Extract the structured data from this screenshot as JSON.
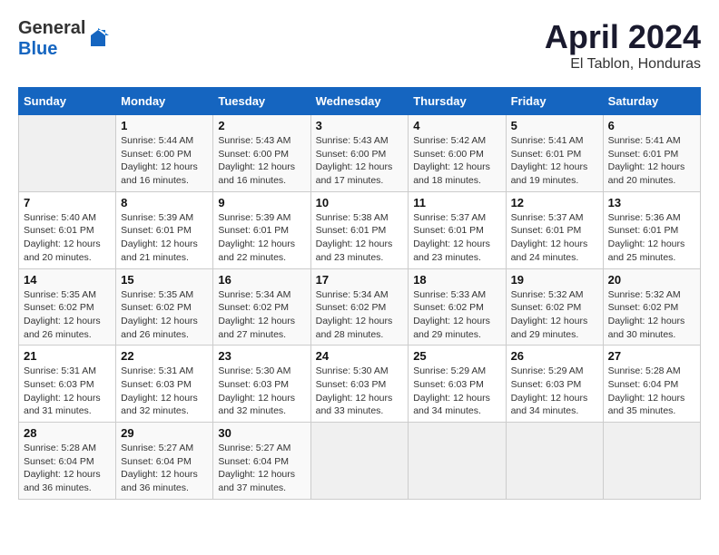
{
  "header": {
    "logo_general": "General",
    "logo_blue": "Blue",
    "title": "April 2024",
    "subtitle": "El Tablon, Honduras"
  },
  "calendar": {
    "columns": [
      "Sunday",
      "Monday",
      "Tuesday",
      "Wednesday",
      "Thursday",
      "Friday",
      "Saturday"
    ],
    "weeks": [
      [
        {
          "day": "",
          "info": ""
        },
        {
          "day": "1",
          "info": "Sunrise: 5:44 AM\nSunset: 6:00 PM\nDaylight: 12 hours\nand 16 minutes."
        },
        {
          "day": "2",
          "info": "Sunrise: 5:43 AM\nSunset: 6:00 PM\nDaylight: 12 hours\nand 16 minutes."
        },
        {
          "day": "3",
          "info": "Sunrise: 5:43 AM\nSunset: 6:00 PM\nDaylight: 12 hours\nand 17 minutes."
        },
        {
          "day": "4",
          "info": "Sunrise: 5:42 AM\nSunset: 6:00 PM\nDaylight: 12 hours\nand 18 minutes."
        },
        {
          "day": "5",
          "info": "Sunrise: 5:41 AM\nSunset: 6:01 PM\nDaylight: 12 hours\nand 19 minutes."
        },
        {
          "day": "6",
          "info": "Sunrise: 5:41 AM\nSunset: 6:01 PM\nDaylight: 12 hours\nand 20 minutes."
        }
      ],
      [
        {
          "day": "7",
          "info": "Sunrise: 5:40 AM\nSunset: 6:01 PM\nDaylight: 12 hours\nand 20 minutes."
        },
        {
          "day": "8",
          "info": "Sunrise: 5:39 AM\nSunset: 6:01 PM\nDaylight: 12 hours\nand 21 minutes."
        },
        {
          "day": "9",
          "info": "Sunrise: 5:39 AM\nSunset: 6:01 PM\nDaylight: 12 hours\nand 22 minutes."
        },
        {
          "day": "10",
          "info": "Sunrise: 5:38 AM\nSunset: 6:01 PM\nDaylight: 12 hours\nand 23 minutes."
        },
        {
          "day": "11",
          "info": "Sunrise: 5:37 AM\nSunset: 6:01 PM\nDaylight: 12 hours\nand 23 minutes."
        },
        {
          "day": "12",
          "info": "Sunrise: 5:37 AM\nSunset: 6:01 PM\nDaylight: 12 hours\nand 24 minutes."
        },
        {
          "day": "13",
          "info": "Sunrise: 5:36 AM\nSunset: 6:01 PM\nDaylight: 12 hours\nand 25 minutes."
        }
      ],
      [
        {
          "day": "14",
          "info": "Sunrise: 5:35 AM\nSunset: 6:02 PM\nDaylight: 12 hours\nand 26 minutes."
        },
        {
          "day": "15",
          "info": "Sunrise: 5:35 AM\nSunset: 6:02 PM\nDaylight: 12 hours\nand 26 minutes."
        },
        {
          "day": "16",
          "info": "Sunrise: 5:34 AM\nSunset: 6:02 PM\nDaylight: 12 hours\nand 27 minutes."
        },
        {
          "day": "17",
          "info": "Sunrise: 5:34 AM\nSunset: 6:02 PM\nDaylight: 12 hours\nand 28 minutes."
        },
        {
          "day": "18",
          "info": "Sunrise: 5:33 AM\nSunset: 6:02 PM\nDaylight: 12 hours\nand 29 minutes."
        },
        {
          "day": "19",
          "info": "Sunrise: 5:32 AM\nSunset: 6:02 PM\nDaylight: 12 hours\nand 29 minutes."
        },
        {
          "day": "20",
          "info": "Sunrise: 5:32 AM\nSunset: 6:02 PM\nDaylight: 12 hours\nand 30 minutes."
        }
      ],
      [
        {
          "day": "21",
          "info": "Sunrise: 5:31 AM\nSunset: 6:03 PM\nDaylight: 12 hours\nand 31 minutes."
        },
        {
          "day": "22",
          "info": "Sunrise: 5:31 AM\nSunset: 6:03 PM\nDaylight: 12 hours\nand 32 minutes."
        },
        {
          "day": "23",
          "info": "Sunrise: 5:30 AM\nSunset: 6:03 PM\nDaylight: 12 hours\nand 32 minutes."
        },
        {
          "day": "24",
          "info": "Sunrise: 5:30 AM\nSunset: 6:03 PM\nDaylight: 12 hours\nand 33 minutes."
        },
        {
          "day": "25",
          "info": "Sunrise: 5:29 AM\nSunset: 6:03 PM\nDaylight: 12 hours\nand 34 minutes."
        },
        {
          "day": "26",
          "info": "Sunrise: 5:29 AM\nSunset: 6:03 PM\nDaylight: 12 hours\nand 34 minutes."
        },
        {
          "day": "27",
          "info": "Sunrise: 5:28 AM\nSunset: 6:04 PM\nDaylight: 12 hours\nand 35 minutes."
        }
      ],
      [
        {
          "day": "28",
          "info": "Sunrise: 5:28 AM\nSunset: 6:04 PM\nDaylight: 12 hours\nand 36 minutes."
        },
        {
          "day": "29",
          "info": "Sunrise: 5:27 AM\nSunset: 6:04 PM\nDaylight: 12 hours\nand 36 minutes."
        },
        {
          "day": "30",
          "info": "Sunrise: 5:27 AM\nSunset: 6:04 PM\nDaylight: 12 hours\nand 37 minutes."
        },
        {
          "day": "",
          "info": ""
        },
        {
          "day": "",
          "info": ""
        },
        {
          "day": "",
          "info": ""
        },
        {
          "day": "",
          "info": ""
        }
      ]
    ]
  }
}
